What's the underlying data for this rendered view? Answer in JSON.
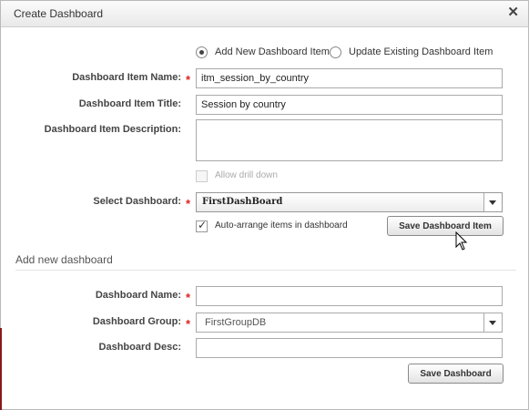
{
  "dialog": {
    "title": "Create Dashboard",
    "close_symbol": "✕"
  },
  "mode": {
    "add_label": "Add New Dashboard Item",
    "update_label": "Update Existing Dashboard Item",
    "selected": "add"
  },
  "item": {
    "name_label": "Dashboard Item Name:",
    "name_value": "itm_session_by_country",
    "title_label": "Dashboard Item Title:",
    "title_value": "Session by country",
    "desc_label": "Dashboard Item Description:",
    "desc_value": "",
    "drill_label": "Allow drill down",
    "select_label": "Select Dashboard:",
    "select_value": "FirstDashBoard",
    "auto_arrange_label": "Auto-arrange items in dashboard",
    "save_item_button": "Save Dashboard Item"
  },
  "new_dashboard": {
    "section_title": "Add new dashboard",
    "name_label": "Dashboard Name:",
    "name_value": "",
    "group_label": "Dashboard Group:",
    "group_value": "FirstGroupDB",
    "desc_label": "Dashboard Desc:",
    "desc_value": "",
    "save_button": "Save Dashboard"
  },
  "required_marker": "*",
  "colors": {
    "required": "#dd2222",
    "title_bar": "#efefef"
  }
}
